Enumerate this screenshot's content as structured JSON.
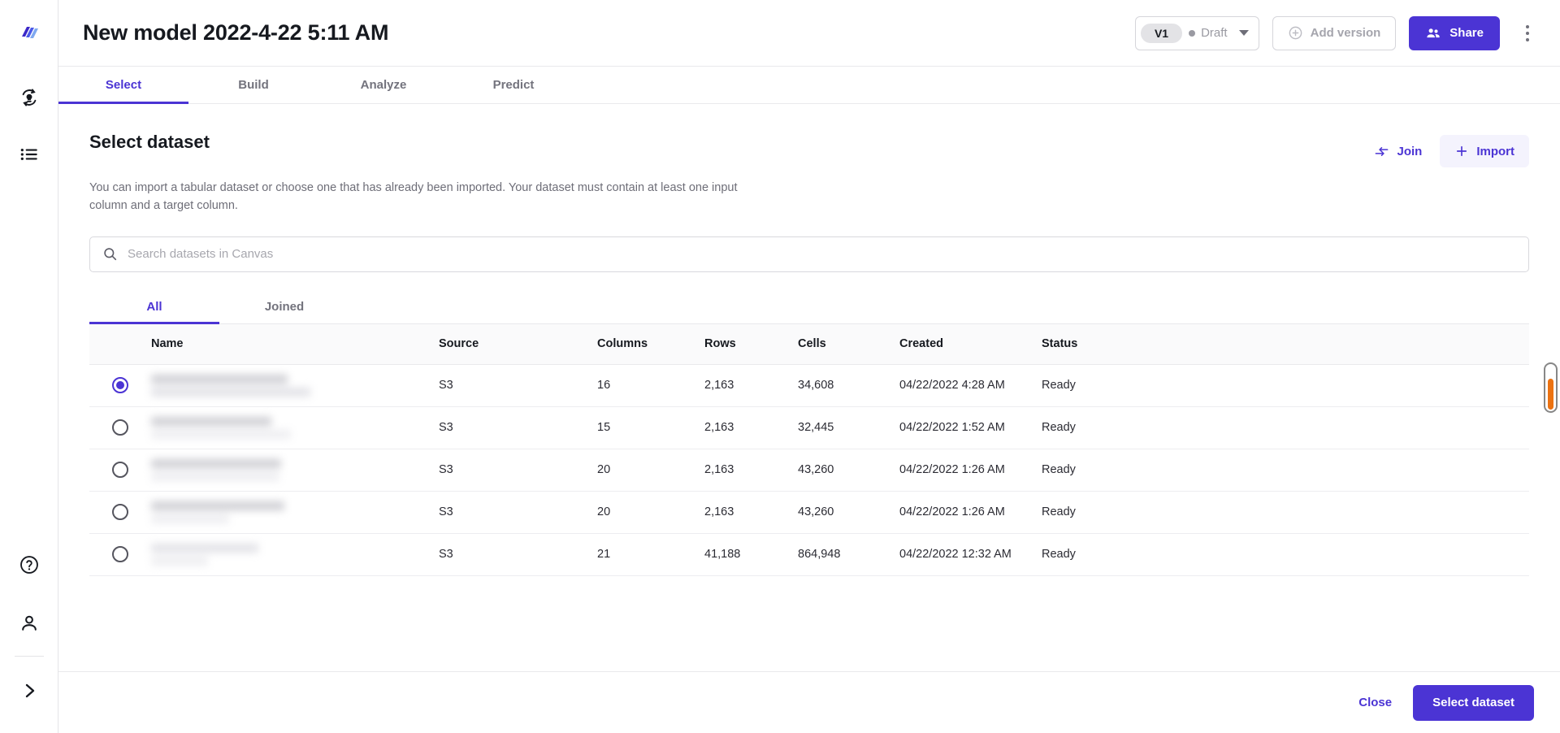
{
  "colors": {
    "accent": "#4b34d4",
    "accent_tint": "#f4f3fd",
    "scrollbar_thumb": "#ec7211",
    "muted_text": "#6e6e78",
    "border": "#e9e9ec"
  },
  "rail": {
    "items": [
      {
        "name": "canvas-logo",
        "icon": "canvas-logo-icon",
        "label": "Canvas"
      },
      {
        "name": "models",
        "icon": "model-bulb-icon",
        "label": "Models"
      },
      {
        "name": "datasets",
        "icon": "list-icon",
        "label": "Datasets"
      }
    ],
    "bottom_items": [
      {
        "name": "help",
        "icon": "help-circle-icon",
        "label": "Help"
      },
      {
        "name": "account",
        "icon": "user-icon",
        "label": "Account"
      },
      {
        "name": "expand",
        "icon": "chevron-right-icon",
        "label": "Expand"
      }
    ]
  },
  "header": {
    "title": "New model 2022-4-22 5:11 AM",
    "version": {
      "chip": "V1",
      "status": "Draft"
    },
    "add_version_label": "Add version",
    "share_label": "Share",
    "more_menu_label": "More options"
  },
  "tabs": [
    {
      "label": "Select",
      "active": true
    },
    {
      "label": "Build",
      "active": false
    },
    {
      "label": "Analyze",
      "active": false
    },
    {
      "label": "Predict",
      "active": false
    }
  ],
  "content": {
    "title": "Select dataset",
    "description": "You can import a tabular dataset or choose one that has already been imported. Your dataset must contain at least one input column and a target column.",
    "join_label": "Join",
    "import_label": "Import"
  },
  "search": {
    "placeholder": "Search datasets in Canvas",
    "value": ""
  },
  "subtabs": [
    {
      "label": "All",
      "active": true
    },
    {
      "label": "Joined",
      "active": false
    }
  ],
  "table": {
    "columns": [
      "Name",
      "Source",
      "Columns",
      "Rows",
      "Cells",
      "Created",
      "Status"
    ],
    "rows": [
      {
        "name": "",
        "redacted": true,
        "selected": true,
        "source": "S3",
        "columns": "16",
        "rows": "2,163",
        "cells": "34,608",
        "created": "04/22/2022 4:28 AM",
        "status": "Ready"
      },
      {
        "name": "",
        "redacted": true,
        "selected": false,
        "source": "S3",
        "columns": "15",
        "rows": "2,163",
        "cells": "32,445",
        "created": "04/22/2022 1:52 AM",
        "status": "Ready"
      },
      {
        "name": "",
        "redacted": true,
        "selected": false,
        "source": "S3",
        "columns": "20",
        "rows": "2,163",
        "cells": "43,260",
        "created": "04/22/2022 1:26 AM",
        "status": "Ready"
      },
      {
        "name": "",
        "redacted": true,
        "selected": false,
        "source": "S3",
        "columns": "20",
        "rows": "2,163",
        "cells": "43,260",
        "created": "04/22/2022 1:26 AM",
        "status": "Ready"
      },
      {
        "name": "",
        "redacted": true,
        "selected": false,
        "source": "S3",
        "columns": "21",
        "rows": "41,188",
        "cells": "864,948",
        "created": "04/22/2022 12:32 AM",
        "status": "Ready"
      }
    ]
  },
  "footer": {
    "close_label": "Close",
    "select_label": "Select dataset"
  },
  "scrollbar": {
    "name": "vertical-scrollbar"
  }
}
